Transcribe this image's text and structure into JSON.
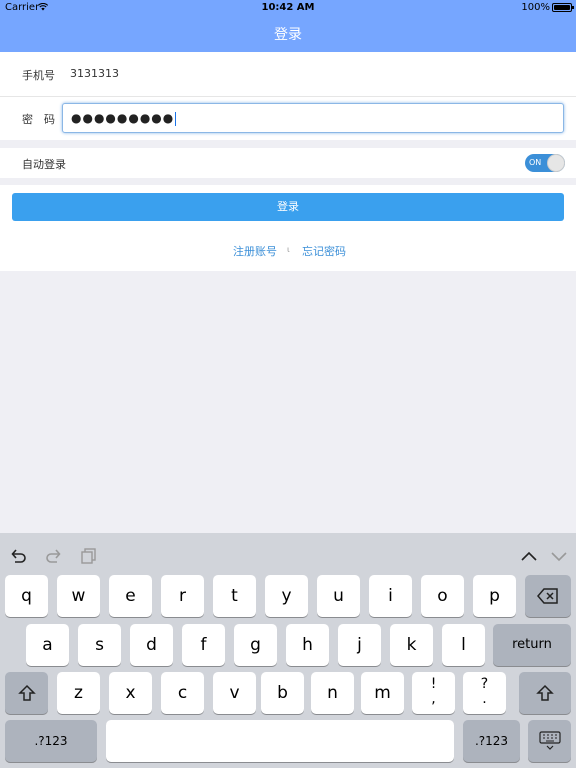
{
  "status_bar": {
    "carrier": "Carrier",
    "time": "10:42 AM",
    "battery": "100%"
  },
  "nav": {
    "title": "登录"
  },
  "form": {
    "phone_label": "手机号",
    "phone_value": "3131313",
    "password_label": "密　码",
    "password_value": "●●●●●●●●●",
    "auto_login_label": "自动登录",
    "auto_login_state": "ON",
    "login_button": "登录",
    "register_link": "注册账号",
    "separator": "ι",
    "forgot_link": "忘记密码"
  },
  "keyboard": {
    "row1": [
      "q",
      "w",
      "e",
      "r",
      "t",
      "y",
      "u",
      "i",
      "o",
      "p"
    ],
    "row2": [
      "a",
      "s",
      "d",
      "f",
      "g",
      "h",
      "j",
      "k",
      "l"
    ],
    "return_label": "return",
    "row3": [
      "z",
      "x",
      "c",
      "v",
      "b",
      "n",
      "m"
    ],
    "punct1_top": "!",
    "punct1_bot": ",",
    "punct2_top": "?",
    "punct2_bot": ".",
    "numbers_label": ".?123"
  },
  "colors": {
    "nav": "#76a6ff",
    "accent": "#3aa0ee",
    "link": "#3b8fd8"
  }
}
